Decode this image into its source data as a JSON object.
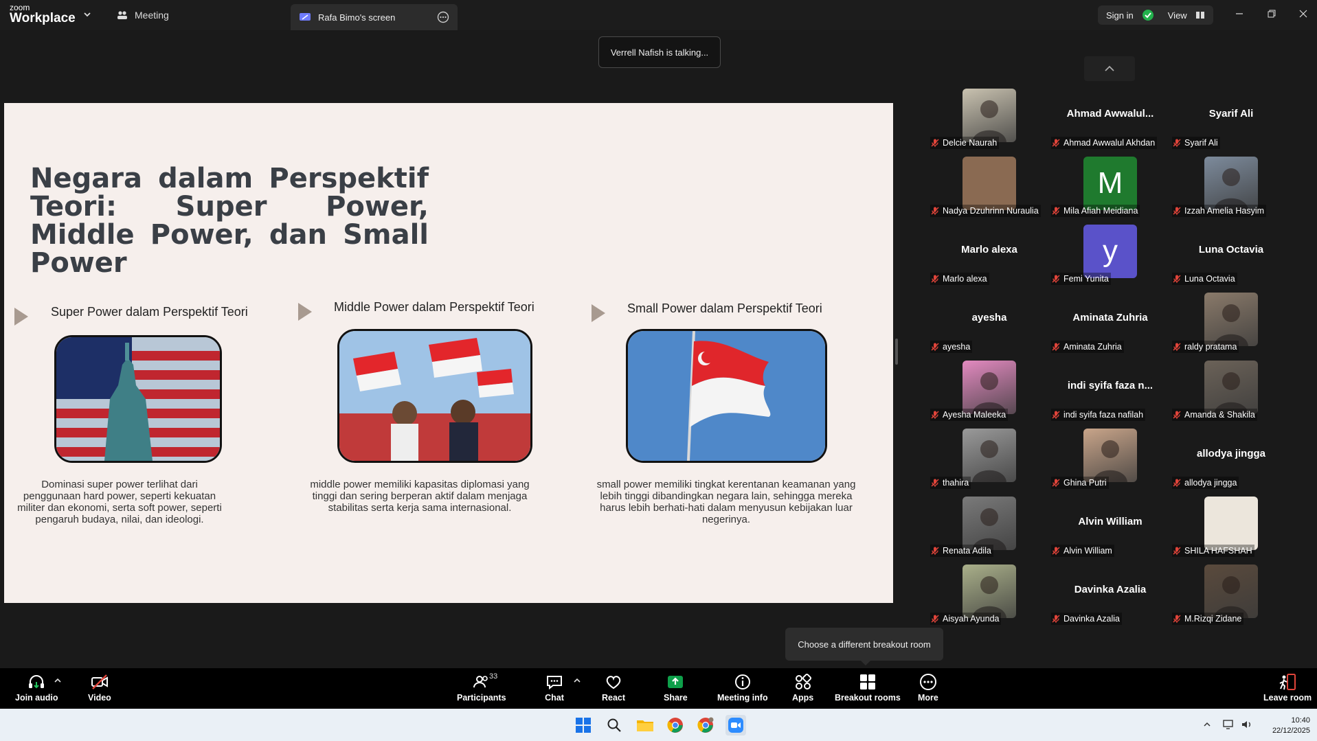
{
  "app": {
    "brand_small": "zoom",
    "brand_big": "Workplace"
  },
  "tabs": {
    "meeting": "Meeting",
    "screen": "Rafa Bimo's screen"
  },
  "header": {
    "sign_in": "Sign in",
    "view": "View"
  },
  "talking": "Verrell Nafish is talking...",
  "slide": {
    "title": "Negara dalam Perspektif Teori: Super Power, Middle Power, dan Small Power",
    "sections": [
      {
        "title": "Super Power dalam Perspektif Teori",
        "desc": "Dominasi super power terlihat dari penggunaan hard power, seperti kekuatan militer dan ekonomi, serta soft power, seperti pengaruh budaya, nilai, dan ideologi."
      },
      {
        "title": "Middle Power dalam Perspektif Teori",
        "desc": "middle power memiliki kapasitas diplomasi yang tinggi dan sering berperan aktif dalam menjaga stabilitas serta kerja sama internasional."
      },
      {
        "title": "Small Power dalam Perspektif Teori",
        "desc": "small power memiliki tingkat kerentanan keamanan yang lebih tinggi dibandingkan negara lain, sehingga mereka harus lebih berhati-hati dalam menyusun kebijakan luar negerinya."
      }
    ]
  },
  "participants": [
    {
      "label": "Delcie Naurah",
      "big": "",
      "video": "photo",
      "color": "#c9c2b0"
    },
    {
      "label": "Ahmad Awwalul Akhdan",
      "big": "Ahmad  Awwalul...",
      "video": "none",
      "color": ""
    },
    {
      "label": "Syarif Ali",
      "big": "Syarif Ali",
      "video": "none",
      "color": ""
    },
    {
      "label": "Nadya Dzuhrinn Nuraulia",
      "big": "",
      "video": "solid",
      "color": "#8a6a52"
    },
    {
      "label": "Mila Afiah Meidiana",
      "big": "",
      "video": "avatar",
      "color": "#1f7a2e",
      "letter": "M"
    },
    {
      "label": "Izzah Amelia Hasyim",
      "big": "",
      "video": "photo",
      "color": "#7d8b9c"
    },
    {
      "label": "Marlo alexa",
      "big": "Marlo alexa",
      "video": "none",
      "color": ""
    },
    {
      "label": "Femi Yunita",
      "big": "",
      "video": "avatar",
      "color": "#5a52c9",
      "letter": "y"
    },
    {
      "label": "Luna Octavia",
      "big": "Luna Octavia",
      "video": "none",
      "color": ""
    },
    {
      "label": "ayesha",
      "big": "ayesha",
      "video": "none",
      "color": ""
    },
    {
      "label": "Aminata Zuhria",
      "big": "Aminata Zuhria",
      "video": "none",
      "color": ""
    },
    {
      "label": "raldy pratama",
      "big": "",
      "video": "photo",
      "color": "#8a7a6a"
    },
    {
      "label": "Ayesha Maleeka",
      "big": "",
      "video": "photo",
      "color": "#e38ac0"
    },
    {
      "label": "indi syifa faza nafilah",
      "big": "indi syifa faza n...",
      "video": "none",
      "color": ""
    },
    {
      "label": "Amanda & Shakila",
      "big": "",
      "video": "photo",
      "color": "#6b6258"
    },
    {
      "label": "thahira",
      "big": "",
      "video": "photo",
      "color": "#9a9a9a"
    },
    {
      "label": "Ghina Putri",
      "big": "",
      "video": "photo",
      "color": "#c9a58a"
    },
    {
      "label": "allodya jingga",
      "big": "allodya jingga",
      "video": "none",
      "color": ""
    },
    {
      "label": "Renata Adila",
      "big": "",
      "video": "photo",
      "color": "#7a7a7a"
    },
    {
      "label": "Alvin William",
      "big": "Alvin William",
      "video": "none",
      "color": ""
    },
    {
      "label": "SHILA HAFSHAH",
      "big": "",
      "video": "solid",
      "color": "#ece6dc"
    },
    {
      "label": "Aisyah Ayunda",
      "big": "",
      "video": "photo",
      "color": "#aab08a"
    },
    {
      "label": "Davinka Azalia",
      "big": "Davinka Azalia",
      "video": "none",
      "color": ""
    },
    {
      "label": "M.Rizqi Zidane",
      "big": "",
      "video": "photo",
      "color": "#5a4a3c"
    }
  ],
  "tooltip": "Choose a different breakout room",
  "toolbar": {
    "join_audio": "Join audio",
    "video": "Video",
    "participants": "Participants",
    "participants_count": "33",
    "chat": "Chat",
    "react": "React",
    "share": "Share",
    "meeting_info": "Meeting info",
    "apps": "Apps",
    "breakout": "Breakout rooms",
    "more": "More",
    "leave": "Leave room"
  },
  "clock": {
    "time": "10:40",
    "date": "22/12/2025"
  },
  "colors": {
    "share_green": "#0e9f4a",
    "mute_red": "#e0443a",
    "slide_bg": "#f6efec"
  }
}
